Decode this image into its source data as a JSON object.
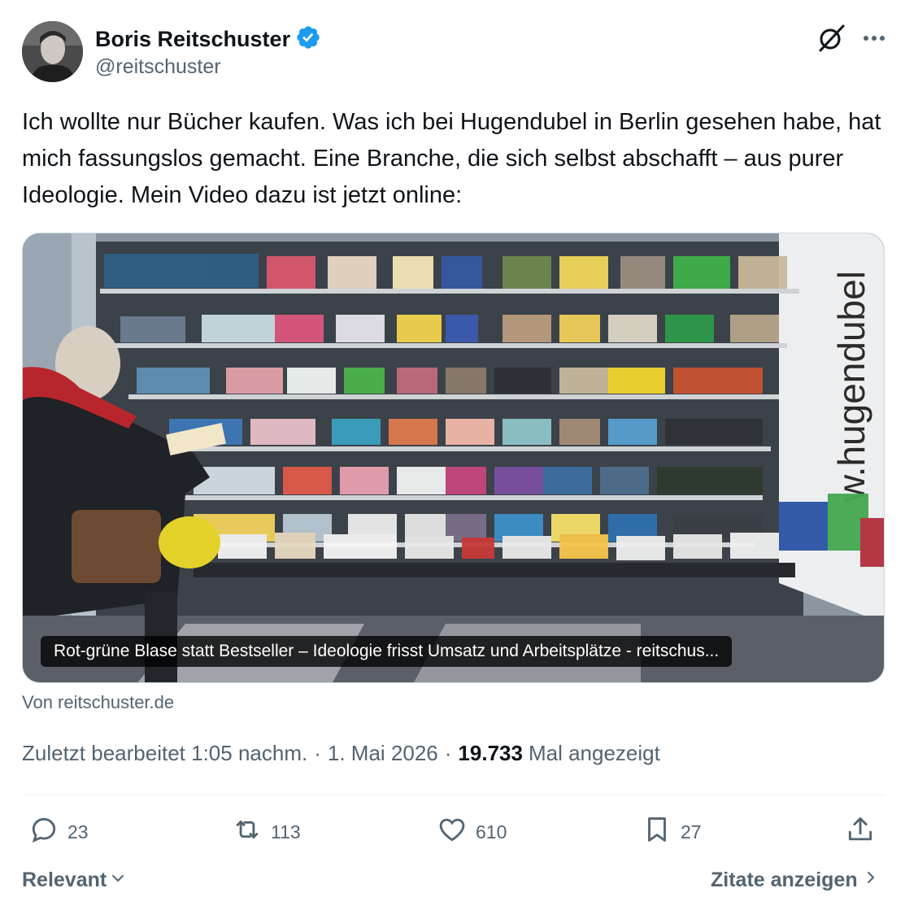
{
  "author": {
    "display_name": "Boris Reitschuster",
    "handle": "@reitschuster",
    "verified_color": "#1d9bf0"
  },
  "header_icons": [
    "grok-icon",
    "more-icon"
  ],
  "tweet": {
    "text": "Ich wollte nur Bücher kaufen. Was ich bei Hugendubel in Berlin gesehen habe, hat mich fassungslos gemacht. Eine Branche, die sich selbst abschafft – aus purer Ideologie. Mein Video dazu ist jetzt online:"
  },
  "card": {
    "caption": "Rot-grüne Blase statt Bestseller – Ideologie frisst Umsatz und Arbeitsplätze - reitschus...",
    "source": "Von reitschuster.de",
    "image_sign_text": "w.hugendubel"
  },
  "meta": {
    "edited": "Zuletzt bearbeitet 1:05 nachm.",
    "separator": "·",
    "date": "1. Mai 2026",
    "views_count": "19.733",
    "views_label": "Mal angezeigt"
  },
  "actions": {
    "replies": "23",
    "reposts": "113",
    "likes": "610",
    "bookmarks": "27"
  },
  "footer": {
    "sort_label": "Relevant",
    "quotes_label": "Zitate anzeigen"
  },
  "colors": {
    "text": "#0f1419",
    "secondary": "#536471",
    "accent": "#1d9bf0"
  }
}
